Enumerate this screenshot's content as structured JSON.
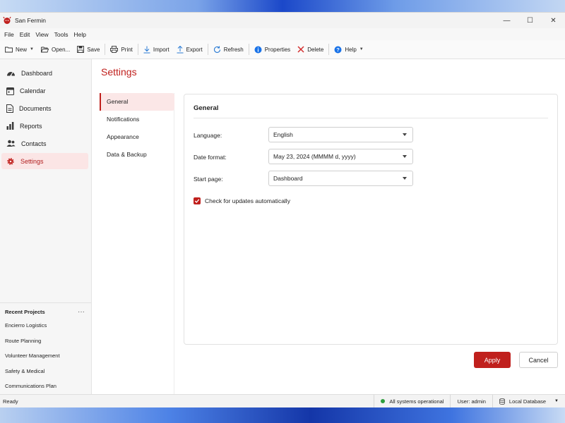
{
  "window": {
    "title": "San Fermin",
    "brand_color": "#c0201d",
    "controls": {
      "minimize": "—",
      "maximize": "☐",
      "close": "✕"
    }
  },
  "menu": [
    {
      "label": "File"
    },
    {
      "label": "Edit"
    },
    {
      "label": "View"
    },
    {
      "label": "Tools"
    },
    {
      "label": "Help"
    }
  ],
  "toolbar": {
    "new": "New",
    "open": "Open...",
    "save": "Save",
    "print": "Print",
    "import": "Import",
    "export": "Export",
    "refresh": "Refresh",
    "properties": "Properties",
    "delete": "Delete",
    "help": "Help"
  },
  "sidebar": {
    "items": [
      {
        "label": "Dashboard",
        "icon": "dashboard-icon"
      },
      {
        "label": "Calendar",
        "icon": "calendar-icon"
      },
      {
        "label": "Documents",
        "icon": "document-icon"
      },
      {
        "label": "Reports",
        "icon": "bar-chart-icon"
      },
      {
        "label": "Contacts",
        "icon": "people-icon"
      },
      {
        "label": "Settings",
        "icon": "gear-icon",
        "active": true
      }
    ],
    "recent": {
      "title": "Recent Projects",
      "more": "···",
      "items": [
        "Encierro Logistics",
        "Route Planning",
        "Volunteer Management",
        "Safety & Medical",
        "Communications Plan"
      ]
    }
  },
  "settings": {
    "title": "Settings",
    "subnav": [
      "General",
      "Notifications",
      "Appearance",
      "Data & Backup"
    ],
    "panel": {
      "title": "General",
      "language": {
        "label": "Language:",
        "value": "English"
      },
      "date_format": {
        "label": "Date format:",
        "value": "May 23, 2024 (MMMM d, yyyy)"
      },
      "start_page": {
        "label": "Start page:",
        "value": "Dashboard"
      },
      "auto_update": {
        "label": "Check for updates automatically",
        "checked": true
      }
    },
    "apply": "Apply",
    "cancel": "Cancel"
  },
  "status": {
    "left": "Ready",
    "systems": "All systems operational",
    "systems_color": "#2e9e3e",
    "user": "User: admin",
    "database": "Local Database"
  }
}
